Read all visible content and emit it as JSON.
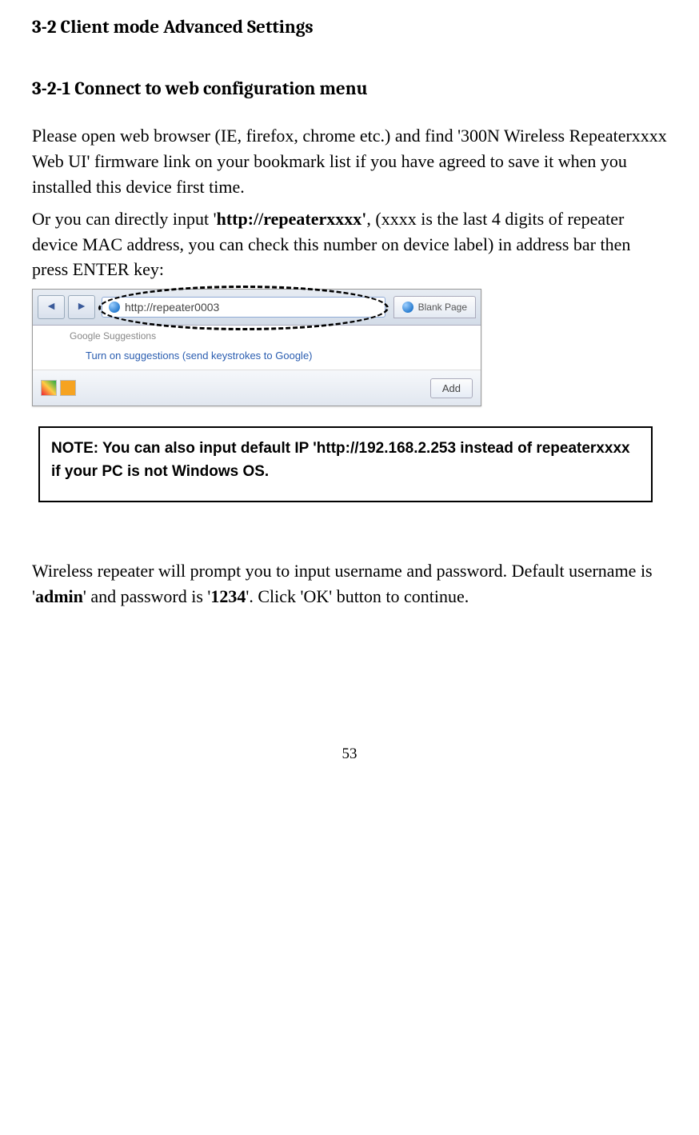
{
  "headings": {
    "main": "3-2 Client mode Advanced Settings",
    "sub": "3-2-1 Connect to web configuration menu"
  },
  "paragraphs": {
    "p1_a": "Please open web browser (IE, firefox, chrome etc.) and find '300N Wireless Repeaterxxxx Web UI' firmware link on your bookmark list if you have agreed to save it when you installed this device first time.",
    "p2_a": "Or you can directly input '",
    "p2_bold": "http://repeaterxxxx'",
    "p2_b": ", (xxxx is the last 4 digits of repeater device MAC address, you can check this number on device label) in address bar then press ENTER key:",
    "p3_a": "Wireless repeater will prompt you to input username and password. Default username is '",
    "p3_bold1": "admin",
    "p3_b": "' and password is '",
    "p3_bold2": "1234",
    "p3_c": "'. Click 'OK' button to continue."
  },
  "browser": {
    "address": "http://repeater0003",
    "tab_label": "Blank Page",
    "suggestion_group": "Google Suggestions",
    "suggestion_text": "Turn on suggestions (send keystrokes to Google)",
    "add_label": "Add"
  },
  "note": {
    "text": "NOTE: You can also input default IP 'http://192.168.2.253 instead of repeaterxxxx if your PC is not Windows OS."
  },
  "page_number": "53"
}
